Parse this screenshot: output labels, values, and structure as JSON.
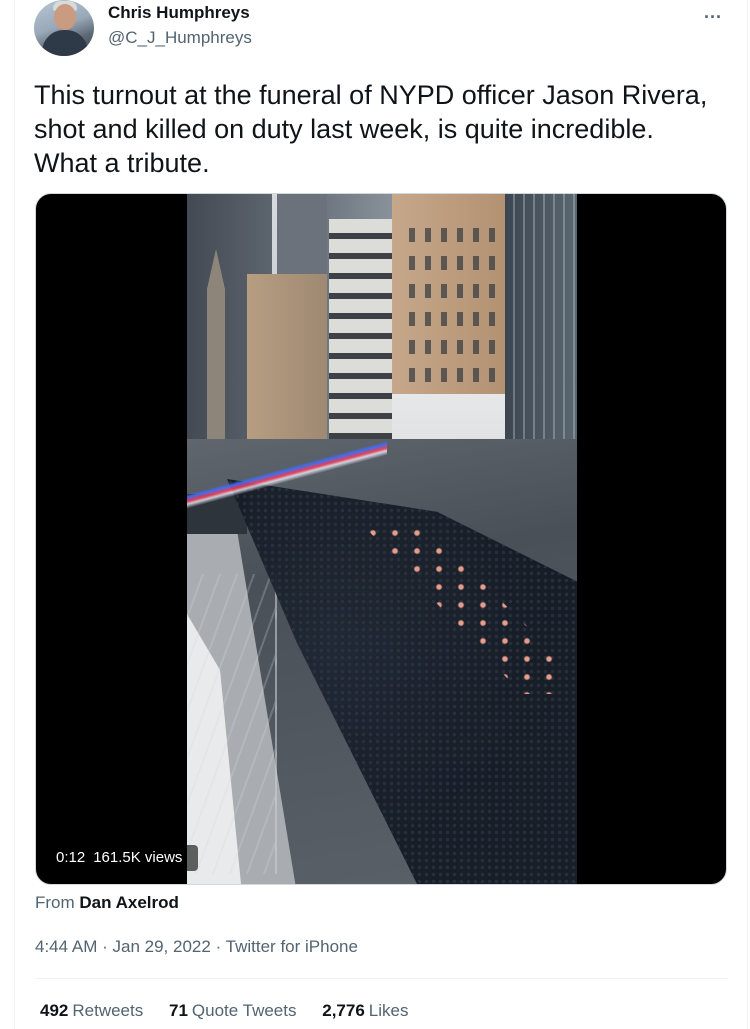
{
  "author": {
    "name": "Chris Humphreys",
    "handle": "@C_J_Humphreys"
  },
  "more_icon": "...",
  "tweet": {
    "text": "This turnout at the funeral of NYPD officer Jason Rivera, shot and killed on duty last week, is quite incredible. What a tribute."
  },
  "media": {
    "duration": "0:12",
    "views": "161.5K views"
  },
  "attribution": {
    "prefix": "From",
    "source": "Dan Axelrod"
  },
  "meta": {
    "time": "4:44 AM",
    "separator": "·",
    "date": "Jan 29, 2022",
    "client": "Twitter for iPhone"
  },
  "stats": {
    "retweets_count": "492",
    "retweets_label": "Retweets",
    "quotes_count": "71",
    "quotes_label": "Quote Tweets",
    "likes_count": "2,776",
    "likes_label": "Likes"
  },
  "colors": {
    "text_primary": "#0f1419",
    "text_secondary": "#536471",
    "divider": "#eff3f4"
  },
  "icons": {
    "avatar": "profile-photo",
    "more": "three-dots-menu"
  }
}
